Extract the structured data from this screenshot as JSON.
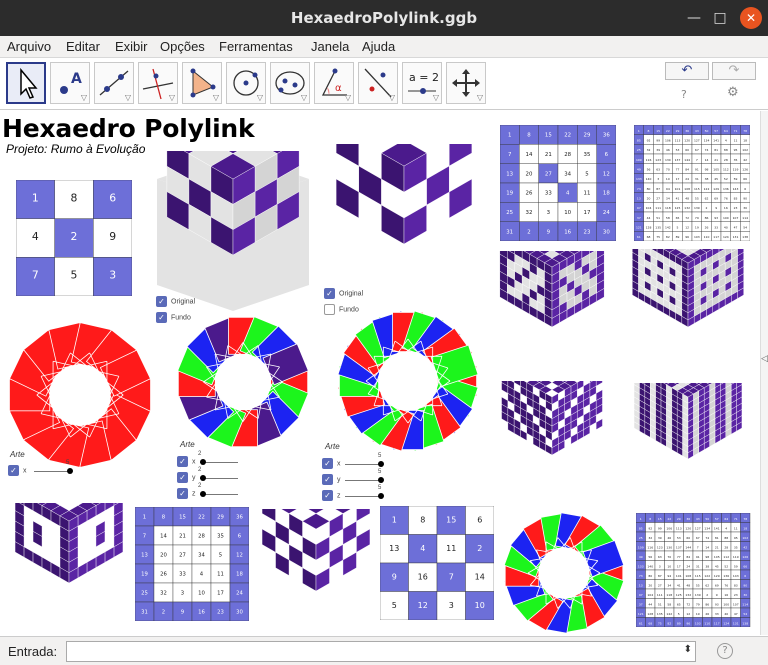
{
  "window": {
    "title": "HexaedroPolylink.ggb"
  },
  "menu": [
    "Arquivo",
    "Editar",
    "Exibir",
    "Opções",
    "Ferramentas",
    "Janela",
    "Ajuda"
  ],
  "toolbar": {
    "tools": [
      "move-tool",
      "point-tool",
      "line-tool",
      "perpendicular-line-tool",
      "polygon-tool",
      "circle-tool",
      "conic-tool",
      "angle-tool",
      "reflect-tool",
      "slider-tool",
      "move-view-tool"
    ],
    "slider_tool_label": "a = 2",
    "undo_label": "↶",
    "redo_label": "↷",
    "help_label": "?",
    "settings_label": "⚙"
  },
  "canvas": {
    "title": "Hexaedro Polylink",
    "subtitle": "Projeto: Rumo à Evolução",
    "checkbox_original": "Original",
    "checkbox_fundo": "Fundo",
    "arte_label": "Arte",
    "slider_x": "x",
    "slider_y": "y",
    "slider_z": "z",
    "slider_value_5": "5",
    "slider_value_2": "2",
    "colors": {
      "purple": "#4b1a8c",
      "grey": "#e3e3e3",
      "red": "#ff1a1a",
      "green": "#1cf51c",
      "blue": "#1c23f2",
      "grid_blue": "#6d6fd8"
    }
  },
  "inputbar": {
    "label": "Entrada:",
    "help": "?"
  },
  "sidebar": {
    "toggle": "◁"
  }
}
